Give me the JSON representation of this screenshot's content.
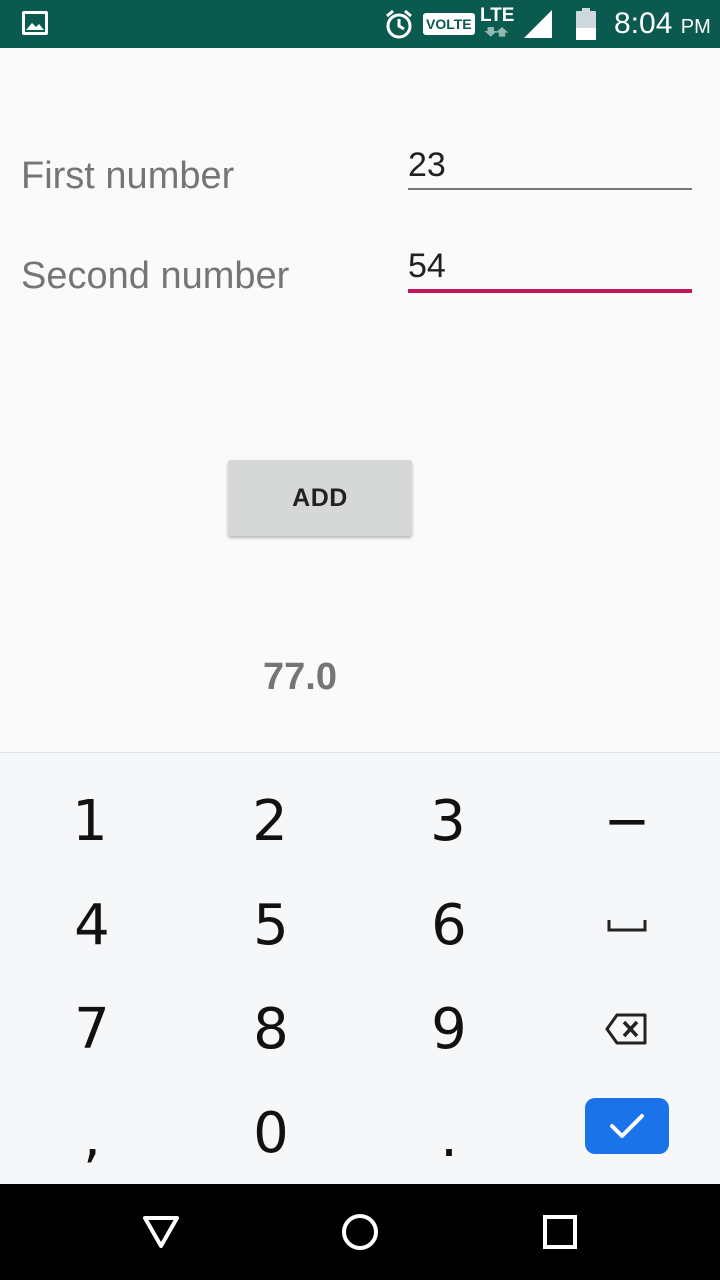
{
  "status_bar": {
    "volte": "VOLTE",
    "network": "LTE",
    "time": "8:04",
    "ampm": "PM",
    "icons": [
      "gallery-icon",
      "alarm-icon",
      "signal-icon",
      "battery-icon"
    ]
  },
  "form": {
    "first_label": "First number",
    "first_value": "23",
    "second_label": "Second number",
    "second_value": "54",
    "accent_color": "#c2185b"
  },
  "add_button": {
    "label": "ADD"
  },
  "result": {
    "value": "77.0"
  },
  "keyboard": {
    "keys": [
      [
        "1",
        "2",
        "3",
        "−"
      ],
      [
        "4",
        "5",
        "6",
        "space-icon"
      ],
      [
        "7",
        "8",
        "9",
        "backspace-icon"
      ],
      [
        ",",
        "0",
        ".",
        "done-check-icon"
      ]
    ],
    "done_color": "#1a73e8"
  },
  "nav_bar": {
    "icons": [
      "back-icon",
      "home-icon",
      "recents-icon"
    ]
  }
}
